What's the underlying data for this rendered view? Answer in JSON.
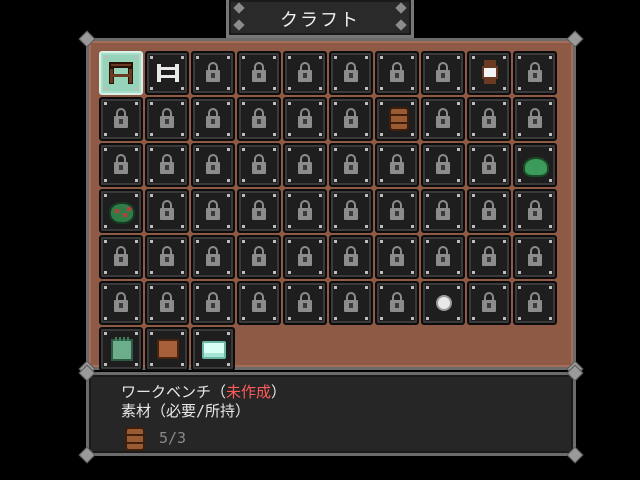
{
  "window": {
    "title": "クラフト"
  },
  "grid": {
    "columns": 10,
    "selected_index": 0,
    "slots": [
      "workbench",
      "railing",
      "locked",
      "locked",
      "locked",
      "locked",
      "locked",
      "locked",
      "lantern",
      "locked",
      "locked",
      "locked",
      "locked",
      "locked",
      "locked",
      "locked",
      "barrel",
      "locked",
      "locked",
      "locked",
      "locked",
      "locked",
      "locked",
      "locked",
      "locked",
      "locked",
      "locked",
      "locked",
      "locked",
      "slime",
      "slime-berries",
      "locked",
      "locked",
      "locked",
      "locked",
      "locked",
      "locked",
      "locked",
      "locked",
      "locked",
      "locked",
      "locked",
      "locked",
      "locked",
      "locked",
      "locked",
      "locked",
      "locked",
      "locked",
      "locked",
      "locked",
      "locked",
      "locked",
      "locked",
      "locked",
      "locked",
      "locked",
      "pearl",
      "locked",
      "locked",
      "moss-block",
      "wood-block",
      "ice-block"
    ]
  },
  "info": {
    "item_name": "ワークベンチ",
    "status_open": "（",
    "status": "未作成",
    "status_close": "）",
    "materials_label": "素材（必要/所持）",
    "material": {
      "icon": "barrel-icon",
      "count": "5/3"
    }
  },
  "colors": {
    "panel_brown": "#8e5a45",
    "status_red": "#ff5a5a",
    "selected_slot": "#95d4b8"
  }
}
